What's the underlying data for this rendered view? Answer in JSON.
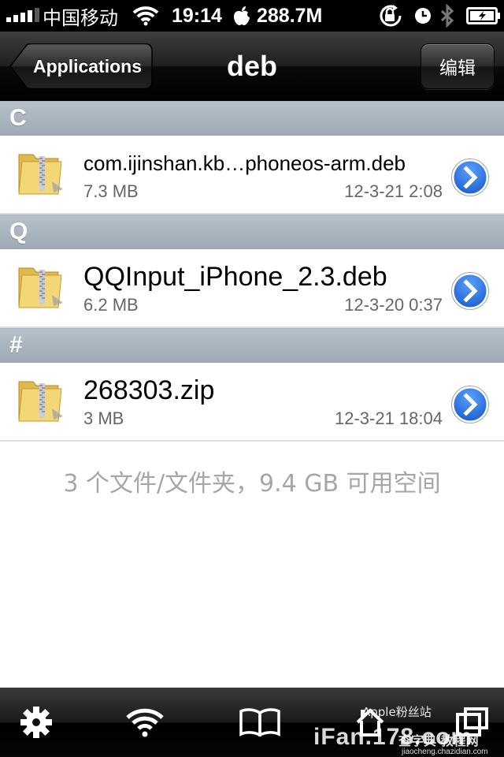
{
  "status_bar": {
    "carrier": "中国移动",
    "time": "19:14",
    "memory": "288.7M"
  },
  "nav": {
    "back_label": "Applications",
    "title": "deb",
    "edit_label": "编辑"
  },
  "sections": [
    {
      "header": "C",
      "files": [
        {
          "name": "com.ijinshan.kb…phoneos-arm.deb",
          "size": "7.3 MB",
          "date": "12-3-21 2:08"
        }
      ]
    },
    {
      "header": "Q",
      "files": [
        {
          "name": "QQInput_iPhone_2.3.deb",
          "size": "6.2 MB",
          "date": "12-3-20 0:37"
        }
      ]
    },
    {
      "header": "#",
      "files": [
        {
          "name": "268303.zip",
          "size": "3 MB",
          "date": "12-3-21 18:04"
        }
      ]
    }
  ],
  "summary": "3 个文件/文件夹，9.4 GB 可用空间",
  "tab_bar": {
    "tabs": [
      "settings-icon",
      "wifi-icon",
      "book-icon",
      "home-icon",
      "windows-icon"
    ]
  },
  "watermark": {
    "brand": "iFan.178.com",
    "sub": "Apple粉丝站",
    "mid": "查字典 教程网",
    "url": "jiaocheng.chazidian.com"
  },
  "colors": {
    "section_header": "#a8b3bd",
    "disclosure_blue": "#1f6fe0",
    "summary_gray": "#a6a6a6"
  }
}
